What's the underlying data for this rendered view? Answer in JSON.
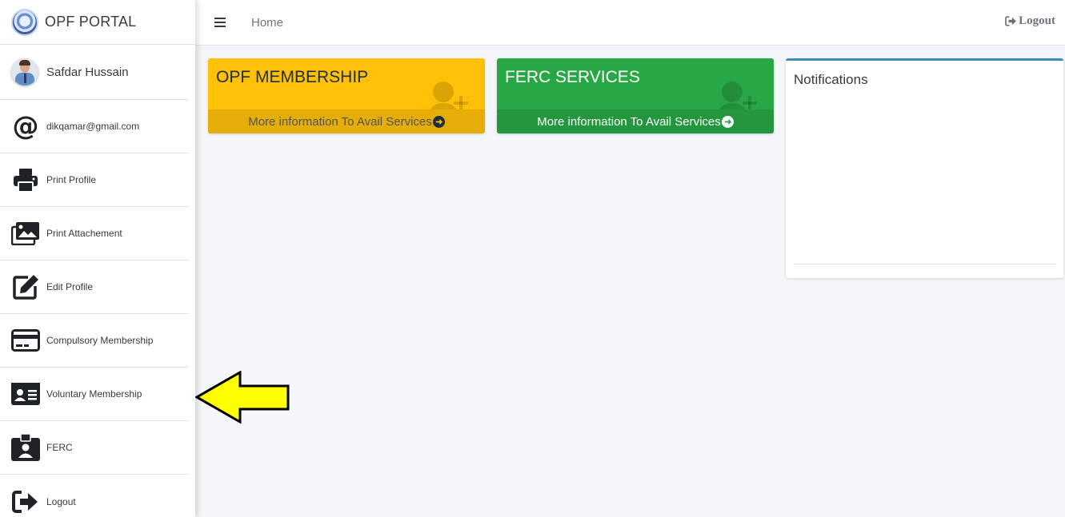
{
  "brand": {
    "title": "OPF PORTAL"
  },
  "user": {
    "name": "Safdar Hussain",
    "email": "dikqamar@gmail.com"
  },
  "sidebar": {
    "items": [
      {
        "label": "Print Profile",
        "icon": "print-icon"
      },
      {
        "label": "Print Attachement",
        "icon": "images-icon"
      },
      {
        "label": "Edit Profile",
        "icon": "edit-icon"
      },
      {
        "label": "Compulsory Membership",
        "icon": "credit-card-icon"
      },
      {
        "label": "Voluntary Membership",
        "icon": "id-card-icon"
      },
      {
        "label": "FERC",
        "icon": "id-badge-icon"
      },
      {
        "label": "Logout",
        "icon": "sign-out-icon"
      }
    ]
  },
  "topbar": {
    "home_label": "Home",
    "logout_label": "Logout"
  },
  "cards": [
    {
      "title": "OPF MEMBERSHIP",
      "footer": "More information To Avail Services",
      "color": "#ffc107"
    },
    {
      "title": "FERC SERVICES",
      "footer": "More information To Avail Services",
      "color": "#28a745"
    }
  ],
  "notifications": {
    "title": "Notifications"
  },
  "colors": {
    "accent": "#3c8dbc",
    "yellow": "#ffc107",
    "green": "#28a745",
    "annotation_arrow": "#ffff00"
  }
}
